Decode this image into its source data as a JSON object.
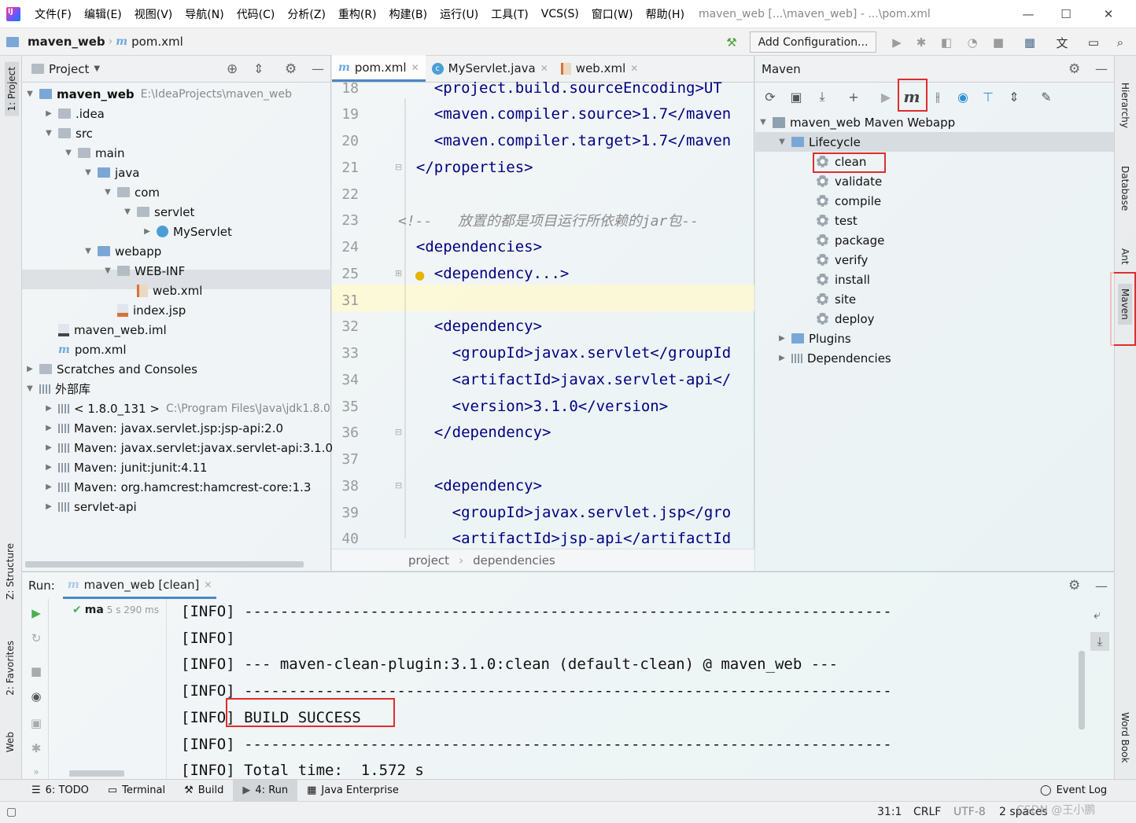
{
  "window": {
    "title": "maven_web [...\\maven_web] - ...\\pom.xml",
    "menu": [
      "文件(F)",
      "编辑(E)",
      "视图(V)",
      "导航(N)",
      "代码(C)",
      "分析(Z)",
      "重构(R)",
      "构建(B)",
      "运行(U)",
      "工具(T)",
      "VCS(S)",
      "窗口(W)",
      "帮助(H)"
    ],
    "minimize": "—",
    "maximize": "☐",
    "close": "✕"
  },
  "navbar": {
    "project": "maven_web",
    "file": "pom.xml",
    "file_icon": "m",
    "add_configuration": "Add Configuration..."
  },
  "left_strip": {
    "project": "1: Project",
    "structure": "Z: Structure",
    "favorites": "2: Favorites",
    "web": "Web"
  },
  "right_strip": {
    "hierarchy": "Hierarchy",
    "database": "Database",
    "ant": "Ant",
    "maven": "Maven",
    "word_book": "Word Book"
  },
  "project_panel": {
    "title": "Project",
    "tree": [
      {
        "label": "maven_web",
        "path": "E:\\IdeaProjects\\maven_web",
        "bold": true
      },
      {
        "label": ".idea"
      },
      {
        "label": "src"
      },
      {
        "label": "main"
      },
      {
        "label": "java"
      },
      {
        "label": "com"
      },
      {
        "label": "servlet"
      },
      {
        "label": "MyServlet"
      },
      {
        "label": "webapp"
      },
      {
        "label": "WEB-INF"
      },
      {
        "label": "web.xml"
      },
      {
        "label": "index.jsp"
      },
      {
        "label": "maven_web.iml"
      },
      {
        "label": "pom.xml"
      },
      {
        "label": "Scratches and Consoles"
      },
      {
        "label": "外部库"
      },
      {
        "label": "< 1.8.0_131 >",
        "path": "C:\\Program Files\\Java\\jdk1.8.0"
      },
      {
        "label": "Maven: javax.servlet.jsp:jsp-api:2.0"
      },
      {
        "label": "Maven: javax.servlet:javax.servlet-api:3.1.0"
      },
      {
        "label": "Maven: junit:junit:4.11"
      },
      {
        "label": "Maven: org.hamcrest:hamcrest-core:1.3"
      },
      {
        "label": "servlet-api"
      }
    ]
  },
  "editor": {
    "tabs": [
      {
        "label": "pom.xml",
        "icon": "m"
      },
      {
        "label": "MyServlet.java",
        "icon": "c"
      },
      {
        "label": "web.xml",
        "icon": "xml"
      }
    ],
    "lines": [
      {
        "n": "18",
        "text": "    <project.build.sourceEncoding>UT"
      },
      {
        "n": "19",
        "text": "    <maven.compiler.source>1.7</maven"
      },
      {
        "n": "20",
        "text": "    <maven.compiler.target>1.7</maven"
      },
      {
        "n": "21",
        "text": "  </properties>"
      },
      {
        "n": "22",
        "text": ""
      },
      {
        "n": "23",
        "text": "<!--   放置的都是项目运行所依赖的jar包--"
      },
      {
        "n": "24",
        "text": "  <dependencies>"
      },
      {
        "n": "25",
        "text": "    <dependency...>"
      },
      {
        "n": "31",
        "text": ""
      },
      {
        "n": "32",
        "text": "    <dependency>"
      },
      {
        "n": "33",
        "text": "      <groupId>javax.servlet</groupId"
      },
      {
        "n": "34",
        "text": "      <artifactId>javax.servlet-api</"
      },
      {
        "n": "35",
        "text": "      <version>3.1.0</version>"
      },
      {
        "n": "36",
        "text": "    </dependency>"
      },
      {
        "n": "37",
        "text": ""
      },
      {
        "n": "38",
        "text": "    <dependency>"
      },
      {
        "n": "39",
        "text": "      <groupId>javax.servlet.jsp</gro"
      },
      {
        "n": "40",
        "text": "      <artifactId>jsp-api</artifactId"
      }
    ],
    "breadcrumb": [
      "project",
      "dependencies"
    ]
  },
  "maven_panel": {
    "title": "Maven",
    "project": "maven_web Maven Webapp",
    "lifecycle_label": "Lifecycle",
    "lifecycle": [
      "clean",
      "validate",
      "compile",
      "test",
      "package",
      "verify",
      "install",
      "site",
      "deploy"
    ],
    "plugins": "Plugins",
    "dependencies": "Dependencies"
  },
  "run_panel": {
    "label": "Run:",
    "config": "maven_web [clean]",
    "tree_item": "ma",
    "tree_time": "5 s 290 ms",
    "console": [
      "[INFO] ------------------------------------------------------------------------",
      "[INFO] ",
      "[INFO] --- maven-clean-plugin:3.1.0:clean (default-clean) @ maven_web ---",
      "[INFO] ------------------------------------------------------------------------",
      "[INFO] BUILD SUCCESS",
      "[INFO] ------------------------------------------------------------------------",
      "[INFO] Total time:  1.572 s"
    ]
  },
  "toolwindows": [
    {
      "label": "6: TODO"
    },
    {
      "label": "Terminal"
    },
    {
      "label": "Build"
    },
    {
      "label": "4: Run"
    },
    {
      "label": "Java Enterprise"
    }
  ],
  "event_log": "Event Log",
  "status": {
    "position": "31:1",
    "line_sep": "CRLF",
    "encoding": "UTF-8",
    "indent": "2 spaces",
    "watermark": "CSDN @王小鹏"
  }
}
